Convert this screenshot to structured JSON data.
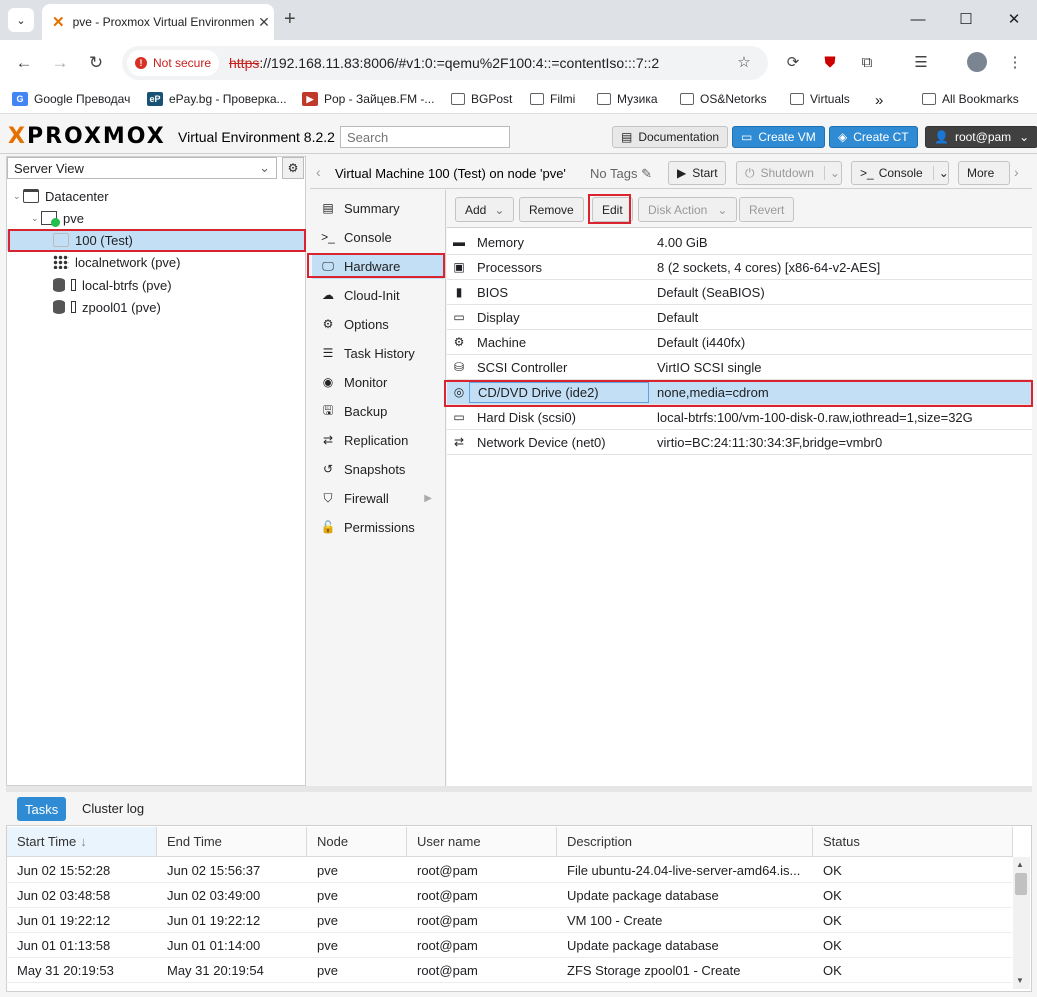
{
  "browser": {
    "tab_title": "pve - Proxmox Virtual Environment",
    "not_secure": "Not secure",
    "url_scheme": "https",
    "url_rest": "://192.168.11.83:8006/#v1:0:=qemu%2F100:4::=contentIso:::7::2",
    "bookmarks": [
      "Google Преводач",
      "ePay.bg - Проверка...",
      "Pop - Зайцев.FM -...",
      "BGPost",
      "Filmi",
      "Музика",
      "OS&Netorks",
      "Virtuals",
      "All Bookmarks"
    ]
  },
  "header": {
    "logo": "PROXMOX",
    "logo_x": "X",
    "logo_rest": "PROXMOX",
    "version": "Virtual Environment 8.2.2",
    "search_placeholder": "Search",
    "documentation": "Documentation",
    "create_vm": "Create VM",
    "create_ct": "Create CT",
    "user": "root@pam"
  },
  "tree": {
    "view": "Server View",
    "items": [
      {
        "label": "Datacenter"
      },
      {
        "label": "pve"
      },
      {
        "label": "100 (Test)"
      },
      {
        "label": "localnetwork (pve)"
      },
      {
        "label": "local-btrfs (pve)"
      },
      {
        "label": "zpool01 (pve)"
      }
    ]
  },
  "vm": {
    "title": "Virtual Machine 100 (Test) on node 'pve'",
    "no_tags": "No Tags",
    "start": "Start",
    "shutdown": "Shutdown",
    "console": "Console",
    "more": "More"
  },
  "nav": [
    "Summary",
    "Console",
    "Hardware",
    "Cloud-Init",
    "Options",
    "Task History",
    "Monitor",
    "Backup",
    "Replication",
    "Snapshots",
    "Firewall",
    "Permissions"
  ],
  "grid_toolbar": {
    "add": "Add",
    "remove": "Remove",
    "edit": "Edit",
    "disk_action": "Disk Action",
    "revert": "Revert"
  },
  "hardware": [
    {
      "key": "Memory",
      "value": "4.00 GiB"
    },
    {
      "key": "Processors",
      "value": "8 (2 sockets, 4 cores) [x86-64-v2-AES]"
    },
    {
      "key": "BIOS",
      "value": "Default (SeaBIOS)"
    },
    {
      "key": "Display",
      "value": "Default"
    },
    {
      "key": "Machine",
      "value": "Default (i440fx)"
    },
    {
      "key": "SCSI Controller",
      "value": "VirtIO SCSI single"
    },
    {
      "key": "CD/DVD Drive (ide2)",
      "value": "none,media=cdrom"
    },
    {
      "key": "Hard Disk (scsi0)",
      "value": "local-btrfs:100/vm-100-disk-0.raw,iothread=1,size=32G"
    },
    {
      "key": "Network Device (net0)",
      "value": "virtio=BC:24:11:30:34:3F,bridge=vmbr0"
    }
  ],
  "tasks": {
    "tab_tasks": "Tasks",
    "tab_cluster": "Cluster log",
    "columns": [
      "Start Time",
      "End Time",
      "Node",
      "User name",
      "Description",
      "Status"
    ],
    "sort_arrow": "↓",
    "rows": [
      [
        "Jun 02 15:52:28",
        "Jun 02 15:56:37",
        "pve",
        "root@pam",
        "File ubuntu-24.04-live-server-amd64.is...",
        "OK"
      ],
      [
        "Jun 02 03:48:58",
        "Jun 02 03:49:00",
        "pve",
        "root@pam",
        "Update package database",
        "OK"
      ],
      [
        "Jun 01 19:22:12",
        "Jun 01 19:22:12",
        "pve",
        "root@pam",
        "VM 100 - Create",
        "OK"
      ],
      [
        "Jun 01 01:13:58",
        "Jun 01 01:14:00",
        "pve",
        "root@pam",
        "Update package database",
        "OK"
      ],
      [
        "May 31 20:19:53",
        "May 31 20:19:54",
        "pve",
        "root@pam",
        "ZFS Storage zpool01 - Create",
        "OK"
      ]
    ]
  }
}
